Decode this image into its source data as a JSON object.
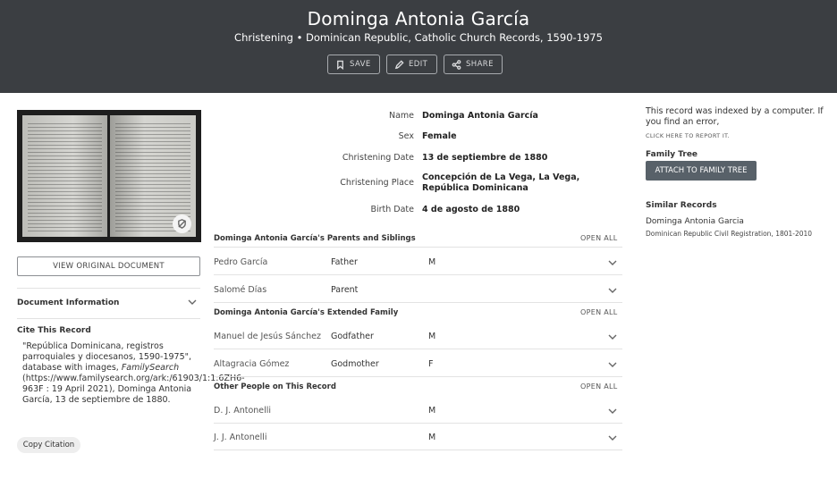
{
  "header": {
    "title": "Dominga Antonia García",
    "subtitle": "Christening • Dominican Republic, Catholic Church Records, 1590-1975",
    "actions": {
      "save": "SAVE",
      "edit": "EDIT",
      "share": "SHARE"
    },
    "background": "#3b3e42"
  },
  "left": {
    "view_document": "VIEW ORIGINAL DOCUMENT",
    "document_information": "Document Information",
    "cite_heading": "Cite This Record",
    "citation": {
      "part1": "\"República Dominicana, registros parroquiales y diocesanos, 1590-1975\", database with images,",
      "italic": "FamilySearch",
      "part2": "(https://www.familysearch.org/ark:/61903/1:1:6ZH6-963F : 19 April 2021), Dominga Antonia García, 13 de septiembre de 1880."
    },
    "copy_citation": "Copy Citation"
  },
  "facts": [
    {
      "label": "Name",
      "value": "Dominga Antonia García"
    },
    {
      "label": "Sex",
      "value": "Female"
    },
    {
      "label": "Christening Date",
      "value": "13 de septiembre de 1880"
    },
    {
      "label": "Christening Place",
      "value_line1": "Concepción de La Vega, La Vega,",
      "value_line2": "República Dominicana"
    },
    {
      "label": "Birth Date",
      "value": "4 de agosto de 1880"
    }
  ],
  "sections": [
    {
      "title": "Dominga Antonia García's Parents and Siblings",
      "open_all": "OPEN ALL",
      "rows": [
        {
          "name": "Pedro García",
          "role": "Father",
          "gender": "M"
        },
        {
          "name": "Salomé Días",
          "role": "Parent",
          "gender": ""
        }
      ]
    },
    {
      "title": "Dominga Antonia García's Extended Family",
      "open_all": "OPEN ALL",
      "rows": [
        {
          "name": "Manuel de Jesús Sánchez",
          "role": "Godfather",
          "gender": "M"
        },
        {
          "name": "Altagracia Gómez",
          "role": "Godmother",
          "gender": "F"
        }
      ]
    },
    {
      "title": "Other People on This Record",
      "open_all": "OPEN ALL",
      "rows": [
        {
          "name": "D. J. Antonelli",
          "role": "",
          "gender": "M"
        },
        {
          "name": "J. J. Antonelli",
          "role": "",
          "gender": "M"
        }
      ]
    }
  ],
  "right": {
    "indexed_note": "This record was indexed by a computer. If you find an error,",
    "report_link": "CLICK HERE TO REPORT IT.",
    "family_tree_heading": "Family Tree",
    "attach_button": "ATTACH TO FAMILY TREE",
    "attach_color": "#586169",
    "similar_heading": "Similar Records",
    "similar": [
      {
        "name": "Dominga Antonia Garcia",
        "collection": "Dominican Republic Civil Registration, 1801-2010"
      }
    ]
  },
  "icons": {
    "save": "bookmark-icon",
    "edit": "pencil-icon",
    "share": "share-icon",
    "image_badge": "shield-icon",
    "expand": "chevron-down-icon"
  }
}
